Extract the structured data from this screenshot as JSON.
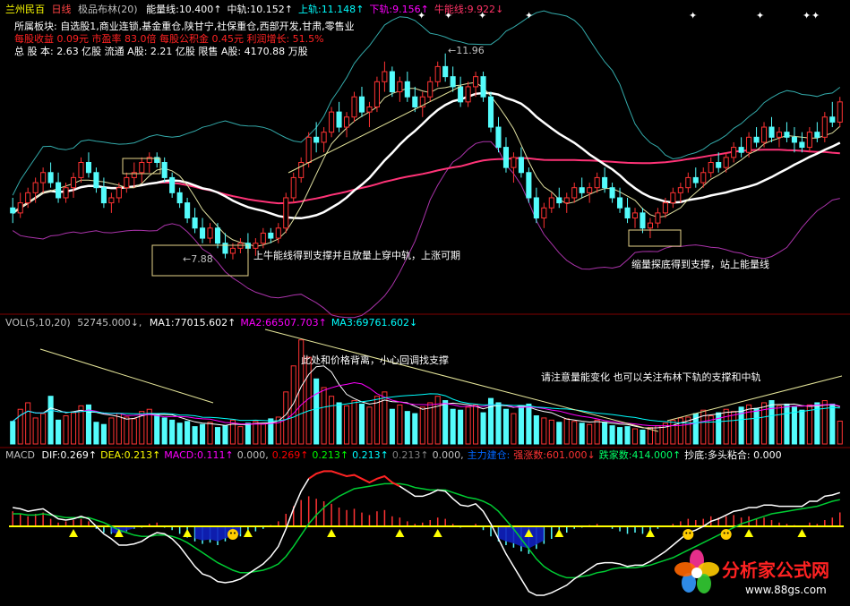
{
  "header": {
    "stock": "兰州民百",
    "period": "日线",
    "indicator": "极品布林(20)",
    "items": [
      {
        "label": "能量线:",
        "value": "10.400",
        "arrow": "↑",
        "color": "#ffffff"
      },
      {
        "label": "中轨:",
        "value": "10.152",
        "arrow": "↑",
        "color": "#ffffff"
      },
      {
        "label": "上轨:",
        "value": "11.148",
        "arrow": "↑",
        "color": "#00ffff"
      },
      {
        "label": "下轨:",
        "value": "9.156",
        "arrow": "↑",
        "color": "#ff00ff"
      },
      {
        "label": "牛能线:",
        "value": "9.922",
        "arrow": "↓",
        "color": "#ff3366"
      }
    ]
  },
  "info": {
    "sector": "所属板块: 自选股1,商业连锁,基金重仓,陕甘宁,社保重仓,西部开发,甘肃,零售业",
    "finance": "每股收益 0.09元 市盈率 83.0倍 每股公积金 0.45元 利润增长: 51.5%",
    "shares": "总 股 本: 2.63  亿股    流通 A股: 2.21  亿股    限售 A股: 4170.88  万股"
  },
  "annotations": {
    "low_price": "7.88",
    "high_price": "11.96",
    "note_support": "上牛能线得到支撑并且放量上穿中轨，上涨可期",
    "note_shrink": "缩量探底得到支撑，站上能量线",
    "note_divergence": "此处和价格背离，小心回调找支撑",
    "note_watch": "请注意量能变化  也可以关注布林下轨的支撑和中轨"
  },
  "vol_header": {
    "name": "VOL(5,10,20)",
    "value": "52745.000",
    "value_arrow": "↓",
    "items": [
      {
        "label": "MA1:",
        "value": "77015.602",
        "arrow": "↑",
        "color": "#ffffff"
      },
      {
        "label": "MA2:",
        "value": "66507.703",
        "arrow": "↑",
        "color": "#ff00ff"
      },
      {
        "label": "MA3:",
        "value": "69761.602",
        "arrow": "↓",
        "color": "#00ffff"
      }
    ]
  },
  "macd_header": {
    "name": "MACD",
    "items": [
      {
        "label": "DIF:",
        "value": "0.269",
        "arrow": "↑",
        "color": "#ffffff"
      },
      {
        "label": "DEA:",
        "value": "0.213",
        "arrow": "↑",
        "color": "#ffff00"
      },
      {
        "label": "MACD:",
        "value": "0.111",
        "arrow": "↑",
        "color": "#ff00ff"
      },
      {
        "label": "",
        "value": "0.000,",
        "arrow": "",
        "color": "#c0c0c0"
      },
      {
        "label": "",
        "value": "0.269",
        "arrow": "↑",
        "color": "#ff0000"
      },
      {
        "label": "",
        "value": "0.213",
        "arrow": "↑",
        "color": "#00ff00"
      },
      {
        "label": "",
        "value": "0.213",
        "arrow": "↑",
        "color": "#00ffff"
      },
      {
        "label": "",
        "value": "0.213",
        "arrow": "↑",
        "color": "#808080"
      },
      {
        "label": "",
        "value": "0.000,",
        "arrow": "",
        "color": "#c0c0c0"
      },
      {
        "label": "主力建仓:",
        "value": "",
        "arrow": "",
        "color": "#0066ff"
      },
      {
        "label": "强涨数:",
        "value": "601.000",
        "arrow": "↓",
        "color": "#ff3333"
      },
      {
        "label": "跌家数:",
        "value": "414.000",
        "arrow": "↑",
        "color": "#00ff66"
      },
      {
        "label": "抄底:",
        "value": "多头粘合: 0.000",
        "arrow": "",
        "color": "#ffffff"
      }
    ]
  },
  "watermark": {
    "brand": "分析家公式网",
    "url": "www.88gs.com"
  },
  "chart_data": [
    {
      "type": "candlestick",
      "name": "price",
      "ohlc": [
        [
          8.9,
          9.1,
          8.6,
          8.8
        ],
        [
          8.8,
          9.2,
          8.7,
          9.0
        ],
        [
          9.0,
          9.3,
          8.9,
          9.2
        ],
        [
          9.2,
          9.5,
          9.0,
          9.4
        ],
        [
          9.4,
          9.7,
          9.2,
          9.6
        ],
        [
          9.6,
          9.8,
          9.3,
          9.4
        ],
        [
          9.4,
          9.6,
          9.0,
          9.1
        ],
        [
          9.1,
          9.4,
          9.0,
          9.3
        ],
        [
          9.3,
          9.6,
          9.1,
          9.5
        ],
        [
          9.5,
          9.9,
          9.4,
          9.8
        ],
        [
          9.8,
          10.0,
          9.5,
          9.6
        ],
        [
          9.6,
          9.7,
          9.2,
          9.3
        ],
        [
          9.3,
          9.5,
          8.9,
          9.0
        ],
        [
          9.0,
          9.2,
          8.8,
          9.1
        ],
        [
          9.1,
          9.4,
          9.0,
          9.3
        ],
        [
          9.3,
          9.6,
          9.2,
          9.5
        ],
        [
          9.5,
          9.8,
          9.3,
          9.6
        ],
        [
          9.6,
          9.9,
          9.4,
          9.8
        ],
        [
          9.8,
          10.0,
          9.6,
          9.9
        ],
        [
          9.9,
          10.0,
          9.7,
          9.8
        ],
        [
          9.8,
          9.9,
          9.4,
          9.5
        ],
        [
          9.5,
          9.6,
          9.1,
          9.2
        ],
        [
          9.2,
          9.3,
          8.9,
          9.0
        ],
        [
          9.0,
          9.1,
          8.6,
          8.7
        ],
        [
          8.7,
          8.9,
          8.4,
          8.5
        ],
        [
          8.5,
          8.7,
          8.2,
          8.3
        ],
        [
          8.3,
          8.6,
          8.2,
          8.5
        ],
        [
          8.5,
          8.6,
          8.1,
          8.2
        ],
        [
          8.2,
          8.4,
          7.9,
          8.0
        ],
        [
          8.0,
          8.2,
          7.88,
          8.1
        ],
        [
          8.1,
          8.3,
          8.0,
          8.2
        ],
        [
          8.2,
          8.4,
          8.0,
          8.1
        ],
        [
          8.1,
          8.3,
          7.95,
          8.2
        ],
        [
          8.2,
          8.5,
          8.1,
          8.4
        ],
        [
          8.4,
          8.5,
          8.2,
          8.3
        ],
        [
          8.3,
          8.6,
          8.2,
          8.5
        ],
        [
          8.5,
          9.2,
          8.4,
          9.1
        ],
        [
          9.1,
          9.6,
          9.0,
          9.5
        ],
        [
          9.5,
          9.9,
          9.4,
          9.8
        ],
        [
          9.8,
          10.4,
          9.7,
          10.3
        ],
        [
          10.3,
          10.6,
          10.0,
          10.2
        ],
        [
          10.2,
          10.5,
          10.0,
          10.4
        ],
        [
          10.4,
          10.9,
          10.3,
          10.8
        ],
        [
          10.8,
          11.0,
          10.4,
          10.5
        ],
        [
          10.5,
          10.8,
          10.3,
          10.7
        ],
        [
          10.7,
          11.2,
          10.6,
          11.1
        ],
        [
          11.1,
          11.3,
          10.7,
          10.8
        ],
        [
          10.8,
          11.0,
          10.5,
          10.9
        ],
        [
          10.9,
          11.5,
          10.8,
          11.4
        ],
        [
          11.4,
          11.8,
          11.2,
          11.6
        ],
        [
          11.6,
          11.7,
          11.1,
          11.2
        ],
        [
          11.2,
          11.5,
          11.0,
          11.4
        ],
        [
          11.4,
          11.6,
          11.0,
          11.1
        ],
        [
          11.1,
          11.3,
          10.8,
          10.9
        ],
        [
          10.9,
          11.2,
          10.7,
          11.1
        ],
        [
          11.1,
          11.5,
          11.0,
          11.4
        ],
        [
          11.4,
          11.8,
          11.3,
          11.7
        ],
        [
          11.7,
          11.96,
          11.4,
          11.5
        ],
        [
          11.5,
          11.7,
          11.2,
          11.3
        ],
        [
          11.3,
          11.5,
          10.9,
          11.0
        ],
        [
          11.0,
          11.4,
          10.9,
          11.3
        ],
        [
          11.3,
          11.6,
          11.1,
          11.5
        ],
        [
          11.5,
          11.6,
          11.0,
          11.1
        ],
        [
          11.1,
          11.2,
          10.4,
          10.5
        ],
        [
          10.5,
          10.7,
          10.0,
          10.1
        ],
        [
          10.1,
          10.3,
          9.6,
          9.7
        ],
        [
          9.7,
          10.0,
          9.4,
          9.9
        ],
        [
          9.9,
          10.1,
          9.5,
          9.6
        ],
        [
          9.6,
          9.7,
          9.0,
          9.1
        ],
        [
          9.1,
          9.3,
          8.6,
          8.7
        ],
        [
          8.7,
          9.0,
          8.5,
          8.9
        ],
        [
          8.9,
          9.2,
          8.8,
          9.1
        ],
        [
          9.1,
          9.3,
          8.9,
          9.0
        ],
        [
          9.0,
          9.2,
          8.8,
          9.1
        ],
        [
          9.1,
          9.4,
          9.0,
          9.3
        ],
        [
          9.3,
          9.5,
          9.1,
          9.2
        ],
        [
          9.2,
          9.4,
          9.0,
          9.3
        ],
        [
          9.3,
          9.6,
          9.2,
          9.5
        ],
        [
          9.5,
          9.7,
          9.2,
          9.3
        ],
        [
          9.3,
          9.4,
          9.0,
          9.1
        ],
        [
          9.1,
          9.3,
          8.8,
          8.9
        ],
        [
          8.9,
          9.1,
          8.6,
          8.7
        ],
        [
          8.7,
          8.9,
          8.5,
          8.8
        ],
        [
          8.8,
          8.9,
          8.4,
          8.5
        ],
        [
          8.5,
          8.7,
          8.3,
          8.6
        ],
        [
          8.6,
          8.9,
          8.5,
          8.8
        ],
        [
          8.8,
          9.1,
          8.7,
          9.0
        ],
        [
          9.0,
          9.3,
          8.9,
          9.2
        ],
        [
          9.2,
          9.4,
          9.0,
          9.3
        ],
        [
          9.3,
          9.6,
          9.2,
          9.5
        ],
        [
          9.5,
          9.7,
          9.3,
          9.4
        ],
        [
          9.4,
          9.7,
          9.3,
          9.6
        ],
        [
          9.6,
          9.9,
          9.5,
          9.8
        ],
        [
          9.8,
          10.0,
          9.6,
          9.7
        ],
        [
          9.7,
          10.0,
          9.6,
          9.9
        ],
        [
          9.9,
          10.2,
          9.8,
          10.1
        ],
        [
          10.1,
          10.3,
          9.9,
          10.0
        ],
        [
          10.0,
          10.4,
          9.9,
          10.3
        ],
        [
          10.3,
          10.5,
          10.1,
          10.2
        ],
        [
          10.2,
          10.6,
          10.1,
          10.5
        ],
        [
          10.5,
          10.7,
          10.2,
          10.3
        ],
        [
          10.3,
          10.5,
          10.1,
          10.4
        ],
        [
          10.4,
          10.6,
          10.2,
          10.3
        ],
        [
          10.3,
          10.5,
          10.0,
          10.2
        ],
        [
          10.2,
          10.4,
          10.0,
          10.1
        ],
        [
          10.1,
          10.5,
          10.0,
          10.4
        ],
        [
          10.4,
          10.6,
          10.2,
          10.3
        ],
        [
          10.3,
          10.8,
          10.2,
          10.7
        ],
        [
          10.7,
          11.0,
          10.5,
          10.6
        ],
        [
          10.6,
          11.1,
          10.5,
          11.0
        ]
      ],
      "high_label": "11.96",
      "low_label": "7.88"
    },
    {
      "type": "bar",
      "name": "volume",
      "values": [
        52,
        80,
        95,
        60,
        70,
        110,
        55,
        65,
        72,
        88,
        90,
        50,
        45,
        60,
        70,
        62,
        58,
        75,
        80,
        66,
        60,
        55,
        48,
        52,
        40,
        45,
        50,
        38,
        42,
        55,
        40,
        48,
        52,
        46,
        58,
        62,
        120,
        180,
        240,
        200,
        150,
        130,
        110,
        95,
        88,
        100,
        92,
        85,
        110,
        120,
        80,
        90,
        75,
        70,
        85,
        95,
        110,
        100,
        80,
        78,
        85,
        90,
        72,
        105,
        95,
        80,
        70,
        88,
        92,
        65,
        60,
        55,
        50,
        58,
        52,
        48,
        45,
        55,
        50,
        42,
        38,
        40,
        35,
        32,
        38,
        42,
        48,
        55,
        60,
        62,
        70,
        78,
        65,
        72,
        80,
        75,
        85,
        90,
        82,
        95,
        100,
        88,
        92,
        85,
        78,
        90,
        95,
        100,
        92,
        52.7
      ],
      "ylim": [
        0,
        260
      ]
    },
    {
      "type": "macd",
      "name": "macd",
      "hist": [
        0.12,
        0.1,
        0.08,
        0.1,
        0.11,
        0.06,
        0.03,
        0.04,
        0.05,
        0.06,
        0.04,
        -0.02,
        -0.05,
        -0.06,
        -0.08,
        -0.04,
        -0.02,
        -0.01,
        0.02,
        0.03,
        -0.01,
        -0.03,
        -0.06,
        -0.09,
        -0.12,
        -0.14,
        -0.13,
        -0.15,
        -0.12,
        -0.1,
        -0.08,
        -0.06,
        -0.04,
        -0.02,
        0.01,
        0.04,
        0.1,
        0.16,
        0.21,
        0.24,
        0.22,
        0.2,
        0.18,
        0.15,
        0.13,
        0.14,
        0.11,
        0.09,
        0.12,
        0.13,
        0.08,
        0.07,
        0.04,
        0.02,
        0.03,
        0.05,
        0.07,
        0.06,
        0.02,
        -0.01,
        0.0,
        0.02,
        -0.03,
        -0.08,
        -0.12,
        -0.15,
        -0.17,
        -0.2,
        -0.22,
        -0.18,
        -0.14,
        -0.1,
        -0.07,
        -0.05,
        -0.02,
        -0.01,
        0.01,
        0.02,
        0.0,
        -0.02,
        -0.04,
        -0.06,
        -0.05,
        -0.06,
        -0.04,
        -0.02,
        0.0,
        0.02,
        0.04,
        0.06,
        0.05,
        0.06,
        0.08,
        0.07,
        0.08,
        0.09,
        0.07,
        0.08,
        0.06,
        0.07,
        0.05,
        0.03,
        0.02,
        0.01,
        0.0,
        0.03,
        0.02,
        0.05,
        0.07,
        0.111
      ],
      "dif": [
        0.15,
        0.14,
        0.12,
        0.13,
        0.14,
        0.1,
        0.06,
        0.05,
        0.06,
        0.08,
        0.06,
        0.0,
        -0.06,
        -0.1,
        -0.15,
        -0.15,
        -0.14,
        -0.12,
        -0.08,
        -0.05,
        -0.06,
        -0.1,
        -0.16,
        -0.24,
        -0.32,
        -0.38,
        -0.4,
        -0.44,
        -0.45,
        -0.44,
        -0.42,
        -0.38,
        -0.34,
        -0.3,
        -0.24,
        -0.16,
        -0.02,
        0.14,
        0.28,
        0.38,
        0.42,
        0.44,
        0.44,
        0.42,
        0.4,
        0.41,
        0.38,
        0.35,
        0.38,
        0.4,
        0.35,
        0.32,
        0.28,
        0.24,
        0.24,
        0.26,
        0.29,
        0.28,
        0.22,
        0.17,
        0.16,
        0.18,
        0.12,
        0.02,
        -0.1,
        -0.22,
        -0.32,
        -0.42,
        -0.52,
        -0.55,
        -0.55,
        -0.53,
        -0.5,
        -0.47,
        -0.42,
        -0.38,
        -0.34,
        -0.3,
        -0.29,
        -0.29,
        -0.3,
        -0.32,
        -0.31,
        -0.31,
        -0.28,
        -0.24,
        -0.2,
        -0.15,
        -0.1,
        -0.05,
        -0.03,
        0.0,
        0.04,
        0.06,
        0.09,
        0.12,
        0.13,
        0.15,
        0.15,
        0.17,
        0.17,
        0.16,
        0.16,
        0.16,
        0.16,
        0.2,
        0.2,
        0.24,
        0.25,
        0.269
      ],
      "dea": [
        0.1,
        0.1,
        0.09,
        0.09,
        0.1,
        0.09,
        0.08,
        0.07,
        0.07,
        0.07,
        0.07,
        0.05,
        0.03,
        0.0,
        -0.03,
        -0.05,
        -0.07,
        -0.08,
        -0.08,
        -0.07,
        -0.07,
        -0.08,
        -0.1,
        -0.13,
        -0.17,
        -0.21,
        -0.25,
        -0.29,
        -0.32,
        -0.35,
        -0.37,
        -0.37,
        -0.36,
        -0.35,
        -0.33,
        -0.3,
        -0.24,
        -0.16,
        -0.07,
        0.02,
        0.09,
        0.15,
        0.2,
        0.24,
        0.27,
        0.3,
        0.31,
        0.32,
        0.33,
        0.34,
        0.34,
        0.34,
        0.33,
        0.31,
        0.3,
        0.29,
        0.29,
        0.29,
        0.27,
        0.25,
        0.23,
        0.22,
        0.2,
        0.17,
        0.12,
        0.05,
        -0.02,
        -0.1,
        -0.18,
        -0.26,
        -0.32,
        -0.36,
        -0.39,
        -0.41,
        -0.41,
        -0.4,
        -0.39,
        -0.37,
        -0.36,
        -0.34,
        -0.33,
        -0.33,
        -0.33,
        -0.32,
        -0.31,
        -0.29,
        -0.27,
        -0.25,
        -0.22,
        -0.19,
        -0.16,
        -0.13,
        -0.1,
        -0.07,
        -0.04,
        -0.01,
        0.02,
        0.04,
        0.06,
        0.08,
        0.1,
        0.11,
        0.12,
        0.13,
        0.14,
        0.15,
        0.16,
        0.18,
        0.2,
        0.213
      ],
      "ylim": [
        -0.6,
        0.5
      ]
    }
  ]
}
